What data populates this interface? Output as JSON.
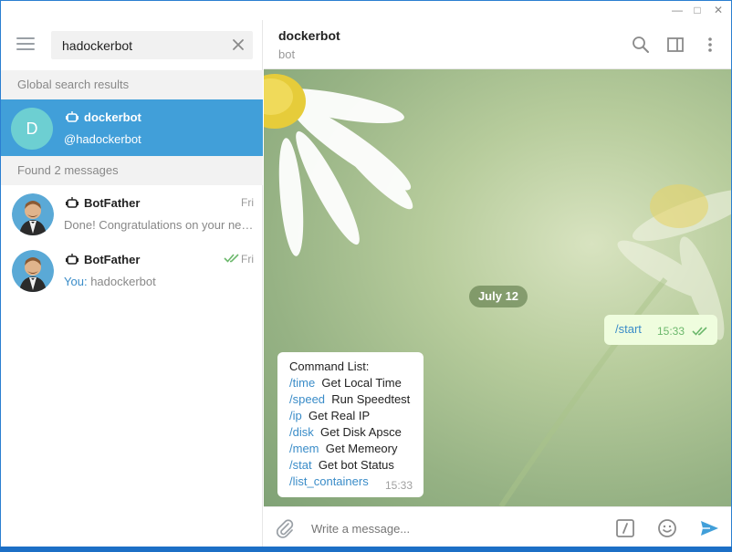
{
  "window": {
    "minimize_glyph": "—",
    "maximize_glyph": "□",
    "close_glyph": "✕"
  },
  "search": {
    "value": "hadockerbot",
    "clear_icon": "close-icon"
  },
  "global_results": {
    "header": "Global search results",
    "items": [
      {
        "avatar_letter": "D",
        "name": "dockerbot",
        "username": "@hadockerbot",
        "avatar_color": "#6dcfd2"
      }
    ]
  },
  "found_messages": {
    "header": "Found 2 messages",
    "items": [
      {
        "name": "BotFather",
        "date": "Fri",
        "text": "Done! Congratulations on your new bot.",
        "prefix": "",
        "read": false
      },
      {
        "name": "BotFather",
        "date": "Fri",
        "text": "hadockerbot",
        "prefix": "You:",
        "read": true
      }
    ]
  },
  "chat": {
    "title": "dockerbot",
    "subtitle": "bot",
    "date_divider": "July 12",
    "outgoing": {
      "text": "/start",
      "time": "15:33"
    },
    "incoming": {
      "heading": "Command List:",
      "commands": [
        {
          "cmd": "/time",
          "desc": "Get Local Time"
        },
        {
          "cmd": "/speed",
          "desc": "Run Speedtest"
        },
        {
          "cmd": "/ip",
          "desc": "Get Real IP"
        },
        {
          "cmd": "/disk",
          "desc": "Get Disk Apsce"
        },
        {
          "cmd": "/mem",
          "desc": "Get Memeory"
        },
        {
          "cmd": "/stat",
          "desc": "Get bot Status"
        },
        {
          "cmd": "/list_containers",
          "desc": ""
        }
      ],
      "time": "15:33"
    },
    "composer_placeholder": "Write a message..."
  },
  "colors": {
    "accent": "#419fd9",
    "link": "#3a8cc8",
    "outgoing_bubble": "#effdde",
    "check": "#6cb86c"
  }
}
